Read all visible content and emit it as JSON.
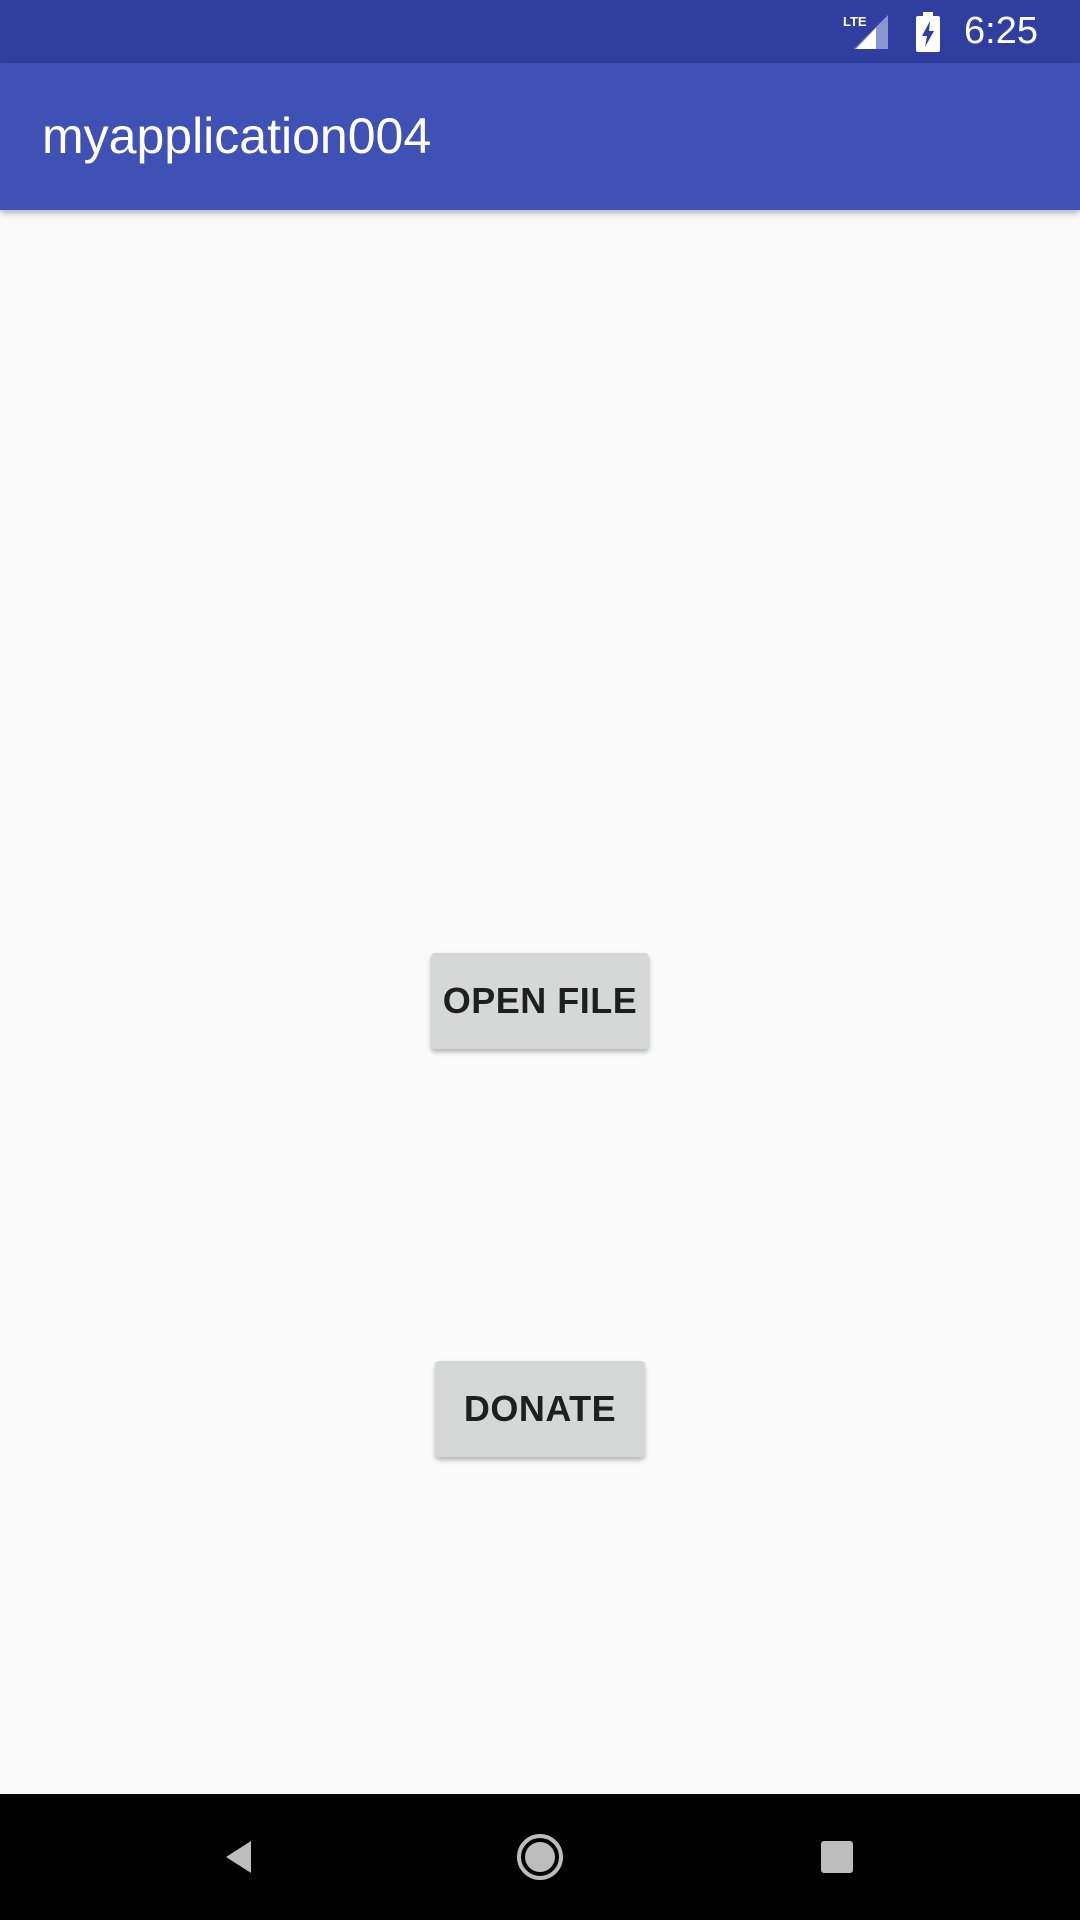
{
  "status_bar": {
    "time": "6:25",
    "network_label": "LTE",
    "icons": [
      "lte-signal-icon",
      "battery-charging-icon"
    ]
  },
  "app_bar": {
    "title": "myapplication004"
  },
  "main": {
    "open_file_label": "OPEN FILE",
    "donate_label": "DONATE"
  },
  "nav_bar": {
    "icons": [
      "back-icon",
      "home-icon",
      "recents-icon"
    ]
  },
  "colors": {
    "status_bar": "#303f9f",
    "app_bar": "#3f51b5",
    "background": "#fafafa",
    "button": "#d6d7d7",
    "nav_bar": "#000000"
  }
}
